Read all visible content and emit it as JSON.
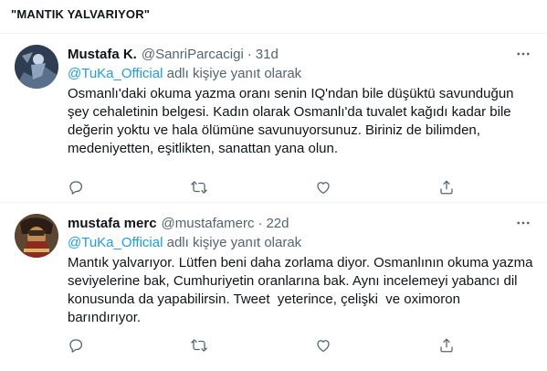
{
  "page": {
    "header": "\"MANTIK YALVARIYOR\""
  },
  "colors": {
    "accent": "#1d9bf0",
    "muted": "#536471",
    "text": "#0f1419",
    "divider": "#eff3f4"
  },
  "tweets": [
    {
      "name": "Mustafa K.",
      "handle": "@SanriParcacigi",
      "separator": "·",
      "time": "31d",
      "reply_mention": "@TuKa_Official",
      "reply_suffix": " adlı kişiye yanıt olarak",
      "text": "Osmanlı'daki okuma yazma oranı senin IQ'ndan bile düşüktü savunduğun\nşey cehaletinin belgesi. Kadın olarak Osmanlı'da tuvalet kağıdı kadar bile\ndeğerin yoktu ve hala ölümüne savunuyorsunuz. Biriniz de bilimden,\nmedeniyetten, eşitlikten, sanattan yana olun.",
      "icons": [
        "more-icon",
        "reply-icon",
        "retweet-icon",
        "like-icon",
        "share-icon"
      ]
    },
    {
      "name": "mustafa merc",
      "handle": "@mustafamerc",
      "separator": "·",
      "time": "22d",
      "reply_mention": "@TuKa_Official",
      "reply_suffix": " adlı kişiye yanıt olarak",
      "text": "Mantık yalvarıyor. Lütfen beni daha zorlama diyor. Osmanlının okuma yazma\nseviyelerine bak, Cumhuriyetin oranlarına bak. Aynı incelemeyi yabancı dil\nkonusunda da yapabilirsin. Tweet  yeterince, çelişki  ve oximoron\nbarındırıyor.",
      "icons": [
        "more-icon",
        "reply-icon",
        "retweet-icon",
        "like-icon",
        "share-icon"
      ]
    }
  ]
}
